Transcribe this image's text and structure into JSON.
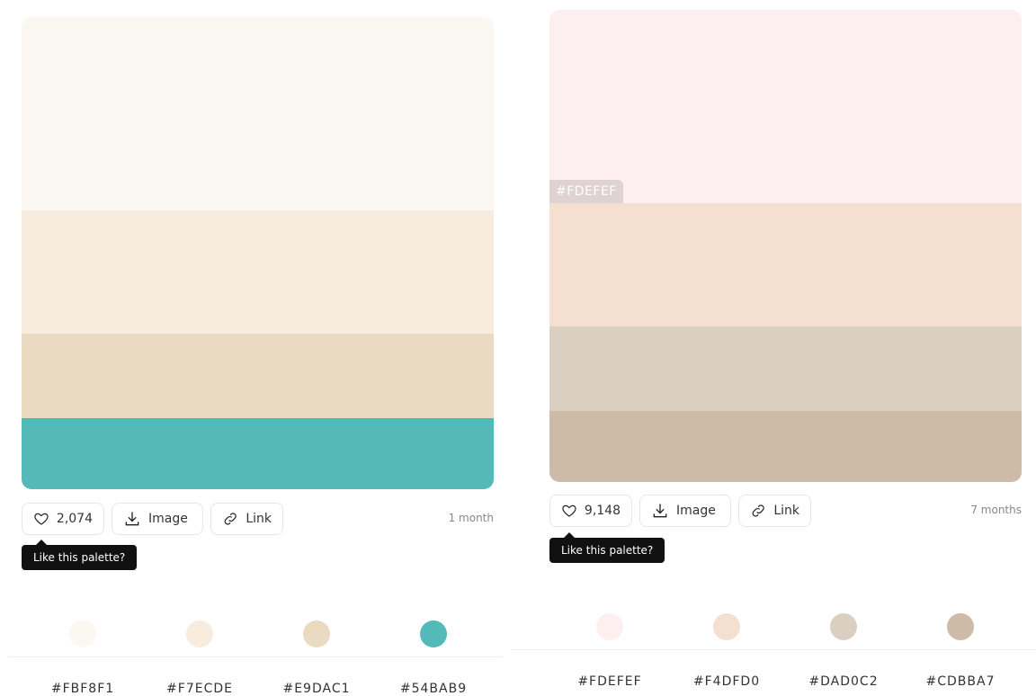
{
  "left_card": {
    "bands": [
      {
        "hex": "#FBF8F1",
        "color": "#FBF8F1"
      },
      {
        "hex": "#F7ECDE",
        "color": "#F7ECDE"
      },
      {
        "hex": "#E9DAC1",
        "color": "#E9DAC1"
      },
      {
        "hex": "#54BAB9",
        "color": "#54BAB9"
      }
    ],
    "likes": "2,074",
    "image_label": "Image",
    "link_label": "Link",
    "age": "1 month",
    "tooltip": "Like this palette?"
  },
  "right_card": {
    "bands": [
      {
        "hex": "#FDEFEF",
        "color": "#FDEFEF"
      },
      {
        "hex": "#F4DFD0",
        "color": "#F4DFD0"
      },
      {
        "hex": "#DAD0C2",
        "color": "#DAD0C2"
      },
      {
        "hex": "#CDBBA7",
        "color": "#CDBBA7"
      }
    ],
    "hover_hex": "#FDEFEF",
    "likes": "9,148",
    "image_label": "Image",
    "link_label": "Link",
    "age": "7 months",
    "tooltip": "Like this palette?"
  },
  "icons": {
    "like": "heart-icon",
    "image": "download-icon",
    "link": "link-icon"
  }
}
